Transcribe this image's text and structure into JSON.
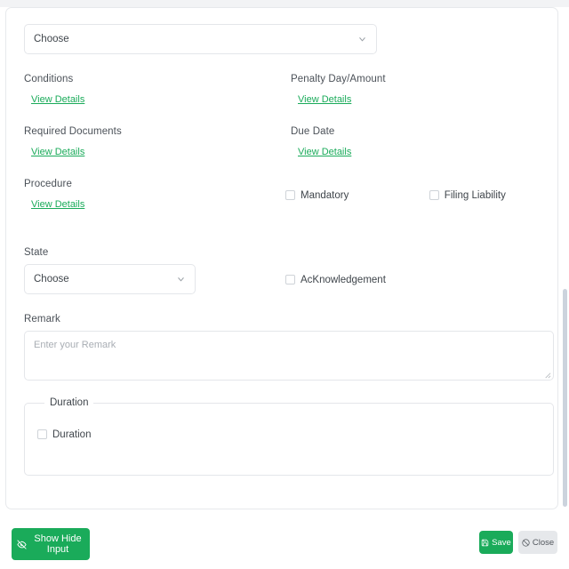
{
  "form": {
    "top_select": {
      "value": "Choose",
      "chevron_icon": "chevron-down-icon"
    },
    "fields": [
      {
        "label": "Conditions",
        "link": "View Details"
      },
      {
        "label": "Penalty Day/Amount",
        "link": "View Details"
      },
      {
        "label": "Required Documents",
        "link": "View Details"
      },
      {
        "label": "Due Date",
        "link": "View Details"
      },
      {
        "label": "Procedure",
        "link": "View Details"
      }
    ],
    "checkboxes": [
      {
        "label": "Mandatory",
        "checked": false
      },
      {
        "label": "Filing Liability",
        "checked": false
      },
      {
        "label": "AcKnowledgement",
        "checked": false
      },
      {
        "label": "Duration",
        "checked": false
      }
    ],
    "state": {
      "label": "State",
      "value": "Choose",
      "chevron_icon": "chevron-down-icon"
    },
    "remark": {
      "label": "Remark",
      "value": "",
      "placeholder": "Enter your Remark"
    },
    "duration_group": {
      "legend": "Duration"
    }
  },
  "footer": {
    "show_hide_label": "Show Hide Input",
    "show_hide_icon": "eye-slash-icon",
    "save_label": "Save",
    "save_icon": "save-disk-icon",
    "close_label": "Close",
    "close_icon": "ban-circle-icon"
  },
  "colors": {
    "primary_green": "#1aab5a",
    "link_green": "#1aab5a",
    "close_grey": "#e6e8eb",
    "border_grey": "#e4e6ea",
    "text_dark": "#3f454b",
    "placeholder_grey": "#a9aeb4",
    "scrollbar_thumb": "#ccd3dd"
  }
}
